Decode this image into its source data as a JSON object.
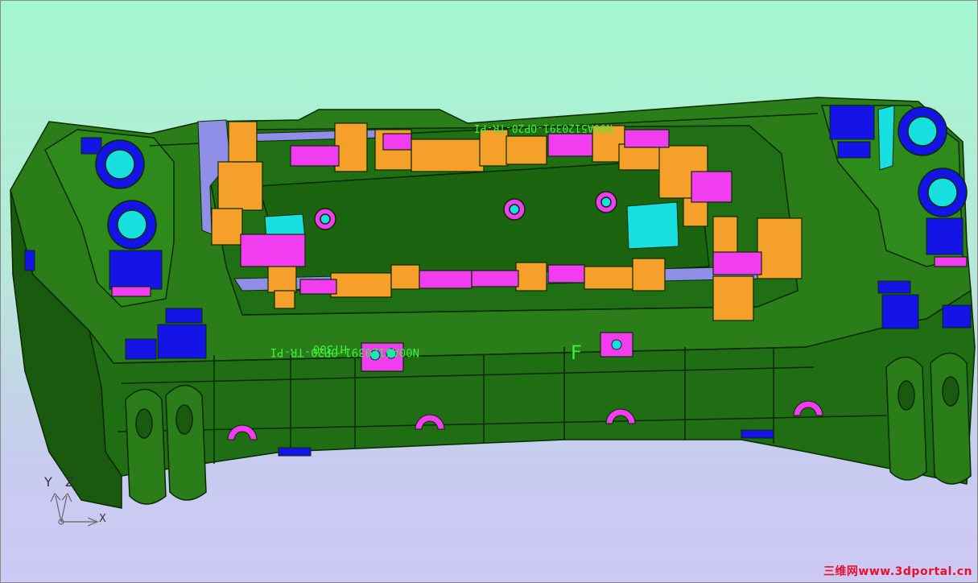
{
  "viewport": {
    "background_top": "#a3f7d0",
    "background_bottom": "#cdc8f5"
  },
  "model": {
    "name": "die-model",
    "part_labels": {
      "front_number": "N00A5120391-OP20-TR-PI",
      "material": "HT300",
      "back_number": "N00A5120391-OP20-TR-PI",
      "mark": "F"
    },
    "colors": {
      "body": "#1f6e13",
      "body_dark": "#0f4a09",
      "edges": "#0a2a05",
      "insert_orange": "#f5a02a",
      "insert_magenta": "#f23cf0",
      "insert_lavender": "#8f8fe8",
      "pad_blue": "#1414e6",
      "pad_cyan": "#18e0e0"
    }
  },
  "axis_triad": {
    "y_label": "Y",
    "z_label": "Z",
    "x_label": "X"
  },
  "watermark": "三维网www.3dportal.cn"
}
